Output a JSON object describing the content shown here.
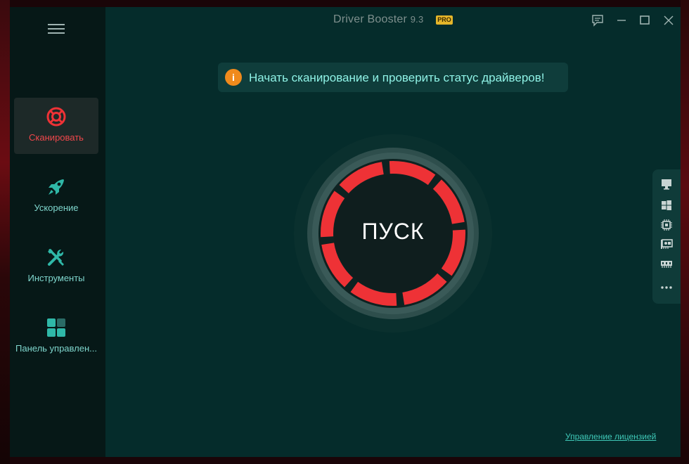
{
  "window": {
    "title": "Driver Booster",
    "version": "9.3",
    "badge": "PRO"
  },
  "sidebar": {
    "items": [
      {
        "label": "Сканировать",
        "icon": "lifebuoy-icon",
        "active": true
      },
      {
        "label": "Ускорение",
        "icon": "rocket-icon",
        "active": false
      },
      {
        "label": "Инструменты",
        "icon": "tools-icon",
        "active": false
      },
      {
        "label": "Панель управлен...",
        "icon": "dashboard-icon",
        "active": false
      }
    ]
  },
  "banner": {
    "icon": "info-icon",
    "text": "Начать сканирование и проверить статус драйверов!"
  },
  "start_button": {
    "label": "ПУСК"
  },
  "side_panel": {
    "icons": [
      "monitor-icon",
      "windows-icon",
      "chip-icon",
      "network-card-icon",
      "memory-icon",
      "more-icon"
    ]
  },
  "footer": {
    "license_link": "Управление лицензией"
  },
  "colors": {
    "background": "#052c2b",
    "sidebar": "#061817",
    "accent_red": "#ee3236",
    "accent_teal": "#3fc9b8",
    "pro_badge": "#e5b62a",
    "info_orange": "#f08a1c"
  }
}
